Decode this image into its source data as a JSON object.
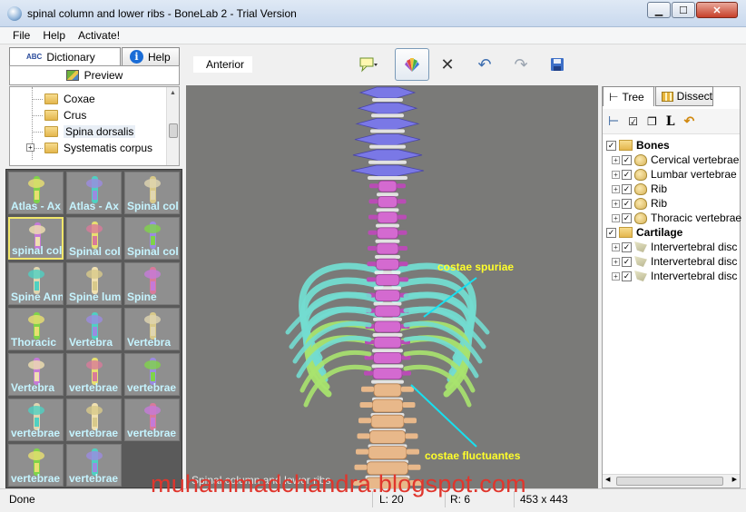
{
  "window": {
    "title": "spinal column and lower ribs - BoneLab 2 - Trial Version"
  },
  "menu": [
    "File",
    "Help",
    "Activate!"
  ],
  "left": {
    "tabs": {
      "dictionary": "Dictionary",
      "help": "Help"
    },
    "preview_label": "Preview",
    "tree": [
      {
        "label": "Coxae"
      },
      {
        "label": "Crus"
      },
      {
        "label": "Spina dorsalis"
      },
      {
        "label": "Systematis corpus"
      }
    ],
    "thumbnails": [
      "Atlas - Ax",
      "Atlas - Ax",
      "Spinal col",
      "spinal col",
      "Spinal col",
      "Spinal col",
      "Spine Ann",
      "Spine lum",
      "Spine",
      "Thoracic",
      "Vertebra",
      "Vertebra",
      "Vertebra",
      "vertebrae",
      "vertebrae",
      "vertebrae",
      "vertebrae",
      "vertebrae",
      "vertebrae",
      "vertebrae"
    ]
  },
  "viewport": {
    "view_name": "Anterior",
    "caption": "Spinal column and lower ribs",
    "annotations": {
      "upper": "costae spuriae",
      "lower": "costae fluctuantes"
    },
    "colors": {
      "cervical": "#7a78e6",
      "thoracic": "#d46ad0",
      "lumbar": "#e8b88a",
      "ribs": "#73dcd0",
      "floating_ribs": "#a8e36e",
      "discs": "#f4f4f4",
      "annotation_text": "#ffff2a",
      "annotation_line": "#17e0f0"
    }
  },
  "right": {
    "tabs": {
      "tree": "Tree",
      "dissect": "Dissect"
    },
    "groups": [
      {
        "label": "Bones",
        "items": [
          "Cervical vertebrae",
          "Lumbar vertebrae",
          "Rib",
          "Rib",
          "Thoracic vertebrae"
        ]
      },
      {
        "label": "Cartilage",
        "items": [
          "Intervertebral disc",
          "Intervertebral disc",
          "Intervertebral disc"
        ]
      }
    ]
  },
  "status": {
    "state": "Done",
    "l": "L: 20",
    "r": "R: 6",
    "size": "453 x 443"
  },
  "watermark": "muhammadchandra.blogspot.com"
}
